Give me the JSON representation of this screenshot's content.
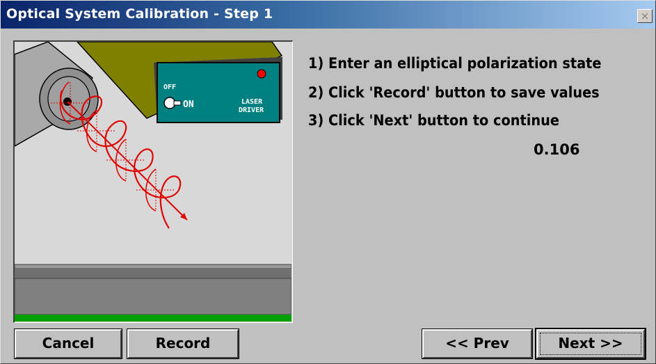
{
  "window": {
    "title": "Optical System Calibration - Step 1",
    "close_glyph": "×"
  },
  "illustration": {
    "switch_off_label": "OFF",
    "switch_on_label": "ON",
    "device_label_line1": "LASER",
    "device_label_line2": "DRIVER",
    "beam_color": "#e00000",
    "device_color": "#008080"
  },
  "instructions": [
    "1) Enter an elliptical polarization state",
    "2) Click 'Record' button to save values",
    "3) Click 'Next' button to continue"
  ],
  "reading_value": "0.106",
  "buttons": {
    "cancel": "Cancel",
    "record": "Record",
    "prev": "<< Prev",
    "next": "Next >>"
  }
}
